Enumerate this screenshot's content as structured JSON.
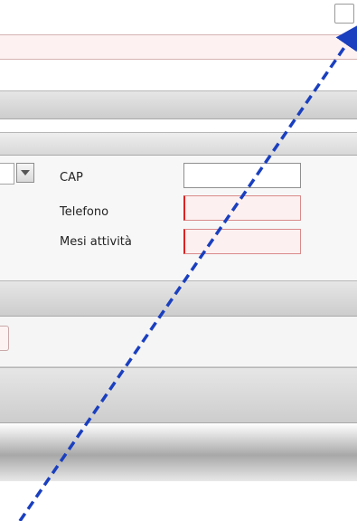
{
  "form": {
    "cap_label": "CAP",
    "telefono_label": "Telefono",
    "mesi_label": "Mesi attività",
    "cap_value": "",
    "telefono_value": "",
    "mesi_value": ""
  },
  "colors": {
    "invalid_background": "#fdf0f0",
    "invalid_border": "#d22222",
    "arrow": "#1a3fbf"
  },
  "icons": {
    "dropdown": "chevron-down-icon",
    "annotation": "arrow-icon"
  }
}
